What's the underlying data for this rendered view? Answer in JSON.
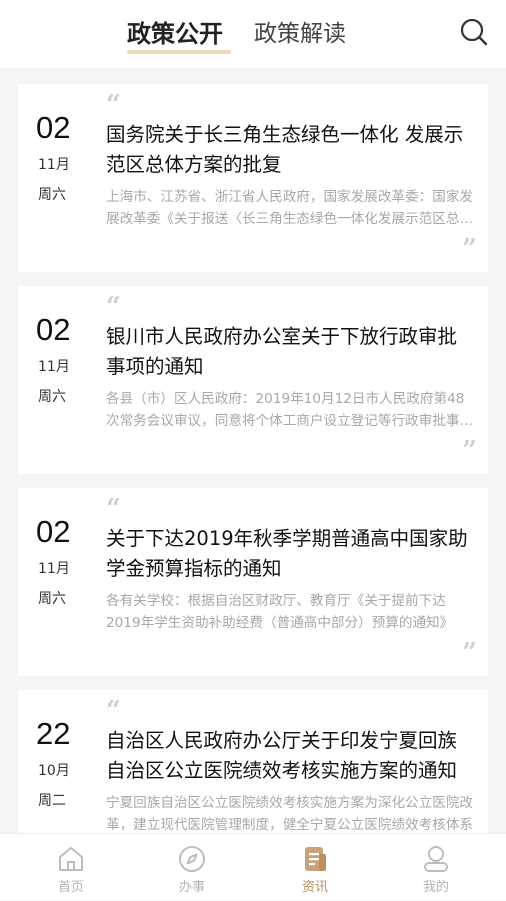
{
  "header": {
    "tabs": [
      {
        "label": "政策公开",
        "active": true
      },
      {
        "label": "政策解读",
        "active": false
      }
    ],
    "search_icon": "search-icon",
    "accent_color": "#f0d9b5"
  },
  "articles": [
    {
      "day": "02",
      "month": "11月",
      "weekday": "周六",
      "title": "国务院关于长三角生态绿色一体化 发展示范区总体方案的批复",
      "summary": "上海市、江苏省、浙江省人民政府，国家发展改革委：国家发展改革委《关于报送〈长三角生态绿色一体化发展示范区总体方案〉的请示》收悉"
    },
    {
      "day": "02",
      "month": "11月",
      "weekday": "周六",
      "title": "银川市人民政府办公室关于下放行政审批事项的通知",
      "summary": "各县（市）区人民政府：2019年10月12日市人民政府第48次常务会议审议，同意将个体工商户设立登记等行政审批事项下放"
    },
    {
      "day": "02",
      "month": "11月",
      "weekday": "周六",
      "title": "关于下达2019年秋季学期普通高中国家助学金预算指标的通知",
      "summary": "各有关学校：根据自治区财政厅、教育厅《关于提前下达2019年学生资助补助经费（普通高中部分）预算的通知》"
    },
    {
      "day": "22",
      "month": "10月",
      "weekday": "周二",
      "title": "自治区人民政府办公厅关于印发宁夏回族自治区公立医院绩效考核实施方案的通知",
      "summary": "宁夏回族自治区公立医院绩效考核实施方案为深化公立医院改革，建立现代医院管理制度，健全宁夏公立医院绩效考核体系"
    }
  ],
  "bottom_nav": [
    {
      "label": "首页",
      "icon": "home-icon",
      "active": false
    },
    {
      "label": "办事",
      "icon": "compass-icon",
      "active": false
    },
    {
      "label": "资讯",
      "icon": "document-icon",
      "active": true
    },
    {
      "label": "我的",
      "icon": "profile-icon",
      "active": false
    }
  ],
  "colors": {
    "active_nav": "#b98f5d",
    "inactive_nav": "#b5b5b5",
    "summary_text": "#a8a8a8"
  }
}
